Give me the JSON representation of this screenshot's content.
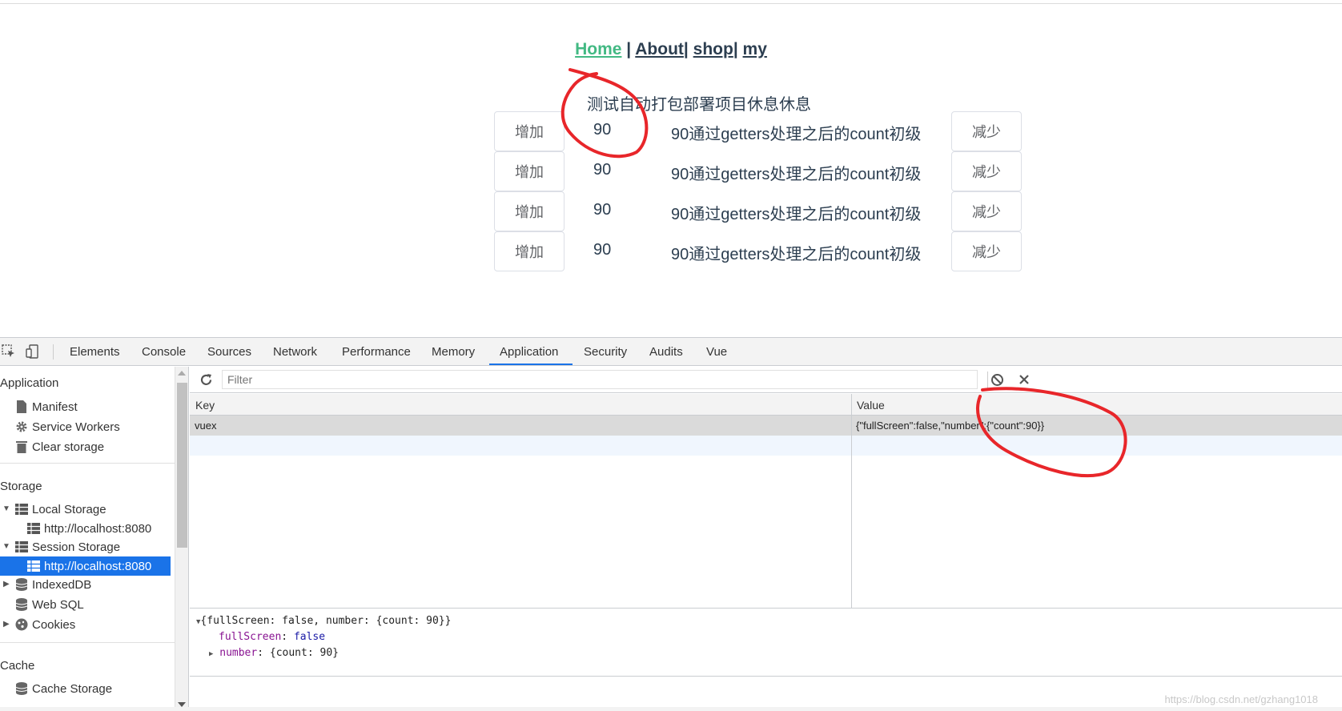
{
  "nav": {
    "home": "Home",
    "about": "About",
    "shop": "shop",
    "my": "my",
    "separator": "|"
  },
  "page": {
    "subtitle": "测试自动打包部署项目休息休息",
    "rows": [
      {
        "add": "增加",
        "count": "90",
        "desc": "90通过getters处理之后的count初级",
        "minus": "减少"
      },
      {
        "add": "增加",
        "count": "90",
        "desc": "90通过getters处理之后的count初级",
        "minus": "减少"
      },
      {
        "add": "增加",
        "count": "90",
        "desc": "90通过getters处理之后的count初级",
        "minus": "减少"
      },
      {
        "add": "增加",
        "count": "90",
        "desc": "90通过getters处理之后的count初级",
        "minus": "减少"
      }
    ]
  },
  "devtools": {
    "tabs": [
      "Elements",
      "Console",
      "Sources",
      "Network",
      "Performance",
      "Memory",
      "Application",
      "Security",
      "Audits",
      "Vue"
    ],
    "active_tab": "Application",
    "sidebar": {
      "application_header": "Application",
      "application_items": [
        "Manifest",
        "Service Workers",
        "Clear storage"
      ],
      "storage_header": "Storage",
      "local_storage": "Local Storage",
      "local_storage_child": "http://localhost:8080",
      "session_storage": "Session Storage",
      "session_storage_child": "http://localhost:8080",
      "indexeddb": "IndexedDB",
      "websql": "Web SQL",
      "cookies": "Cookies",
      "cache_header": "Cache",
      "cache_storage": "Cache Storage"
    },
    "filter_placeholder": "Filter",
    "grid": {
      "key_header": "Key",
      "value_header": "Value",
      "rows": [
        {
          "key": "vuex",
          "value": "{\"fullScreen\":false,\"number\":{\"count\":90}}"
        }
      ]
    },
    "preview": {
      "line1": "{fullScreen: false, number: {count: 90}}",
      "line2_key": "fullScreen",
      "line2_value": "false",
      "line3_key": "number",
      "line3_value": "{count: 90}"
    },
    "watermark": "https://blog.csdn.net/gzhang1018"
  },
  "colors": {
    "accent": "#1a73e8",
    "link_active": "#42b983",
    "text": "#2c3e50",
    "annotation": "#e8262a"
  }
}
